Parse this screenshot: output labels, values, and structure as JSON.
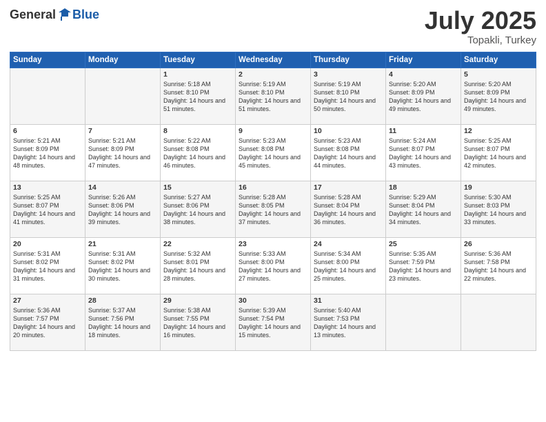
{
  "header": {
    "logo_general": "General",
    "logo_blue": "Blue",
    "month": "July 2025",
    "location": "Topakli, Turkey"
  },
  "days_of_week": [
    "Sunday",
    "Monday",
    "Tuesday",
    "Wednesday",
    "Thursday",
    "Friday",
    "Saturday"
  ],
  "weeks": [
    [
      {
        "day": "",
        "info": ""
      },
      {
        "day": "",
        "info": ""
      },
      {
        "day": "1",
        "info": "Sunrise: 5:18 AM\nSunset: 8:10 PM\nDaylight: 14 hours and 51 minutes."
      },
      {
        "day": "2",
        "info": "Sunrise: 5:19 AM\nSunset: 8:10 PM\nDaylight: 14 hours and 51 minutes."
      },
      {
        "day": "3",
        "info": "Sunrise: 5:19 AM\nSunset: 8:10 PM\nDaylight: 14 hours and 50 minutes."
      },
      {
        "day": "4",
        "info": "Sunrise: 5:20 AM\nSunset: 8:09 PM\nDaylight: 14 hours and 49 minutes."
      },
      {
        "day": "5",
        "info": "Sunrise: 5:20 AM\nSunset: 8:09 PM\nDaylight: 14 hours and 49 minutes."
      }
    ],
    [
      {
        "day": "6",
        "info": "Sunrise: 5:21 AM\nSunset: 8:09 PM\nDaylight: 14 hours and 48 minutes."
      },
      {
        "day": "7",
        "info": "Sunrise: 5:21 AM\nSunset: 8:09 PM\nDaylight: 14 hours and 47 minutes."
      },
      {
        "day": "8",
        "info": "Sunrise: 5:22 AM\nSunset: 8:08 PM\nDaylight: 14 hours and 46 minutes."
      },
      {
        "day": "9",
        "info": "Sunrise: 5:23 AM\nSunset: 8:08 PM\nDaylight: 14 hours and 45 minutes."
      },
      {
        "day": "10",
        "info": "Sunrise: 5:23 AM\nSunset: 8:08 PM\nDaylight: 14 hours and 44 minutes."
      },
      {
        "day": "11",
        "info": "Sunrise: 5:24 AM\nSunset: 8:07 PM\nDaylight: 14 hours and 43 minutes."
      },
      {
        "day": "12",
        "info": "Sunrise: 5:25 AM\nSunset: 8:07 PM\nDaylight: 14 hours and 42 minutes."
      }
    ],
    [
      {
        "day": "13",
        "info": "Sunrise: 5:25 AM\nSunset: 8:07 PM\nDaylight: 14 hours and 41 minutes."
      },
      {
        "day": "14",
        "info": "Sunrise: 5:26 AM\nSunset: 8:06 PM\nDaylight: 14 hours and 39 minutes."
      },
      {
        "day": "15",
        "info": "Sunrise: 5:27 AM\nSunset: 8:06 PM\nDaylight: 14 hours and 38 minutes."
      },
      {
        "day": "16",
        "info": "Sunrise: 5:28 AM\nSunset: 8:05 PM\nDaylight: 14 hours and 37 minutes."
      },
      {
        "day": "17",
        "info": "Sunrise: 5:28 AM\nSunset: 8:04 PM\nDaylight: 14 hours and 36 minutes."
      },
      {
        "day": "18",
        "info": "Sunrise: 5:29 AM\nSunset: 8:04 PM\nDaylight: 14 hours and 34 minutes."
      },
      {
        "day": "19",
        "info": "Sunrise: 5:30 AM\nSunset: 8:03 PM\nDaylight: 14 hours and 33 minutes."
      }
    ],
    [
      {
        "day": "20",
        "info": "Sunrise: 5:31 AM\nSunset: 8:02 PM\nDaylight: 14 hours and 31 minutes."
      },
      {
        "day": "21",
        "info": "Sunrise: 5:31 AM\nSunset: 8:02 PM\nDaylight: 14 hours and 30 minutes."
      },
      {
        "day": "22",
        "info": "Sunrise: 5:32 AM\nSunset: 8:01 PM\nDaylight: 14 hours and 28 minutes."
      },
      {
        "day": "23",
        "info": "Sunrise: 5:33 AM\nSunset: 8:00 PM\nDaylight: 14 hours and 27 minutes."
      },
      {
        "day": "24",
        "info": "Sunrise: 5:34 AM\nSunset: 8:00 PM\nDaylight: 14 hours and 25 minutes."
      },
      {
        "day": "25",
        "info": "Sunrise: 5:35 AM\nSunset: 7:59 PM\nDaylight: 14 hours and 23 minutes."
      },
      {
        "day": "26",
        "info": "Sunrise: 5:36 AM\nSunset: 7:58 PM\nDaylight: 14 hours and 22 minutes."
      }
    ],
    [
      {
        "day": "27",
        "info": "Sunrise: 5:36 AM\nSunset: 7:57 PM\nDaylight: 14 hours and 20 minutes."
      },
      {
        "day": "28",
        "info": "Sunrise: 5:37 AM\nSunset: 7:56 PM\nDaylight: 14 hours and 18 minutes."
      },
      {
        "day": "29",
        "info": "Sunrise: 5:38 AM\nSunset: 7:55 PM\nDaylight: 14 hours and 16 minutes."
      },
      {
        "day": "30",
        "info": "Sunrise: 5:39 AM\nSunset: 7:54 PM\nDaylight: 14 hours and 15 minutes."
      },
      {
        "day": "31",
        "info": "Sunrise: 5:40 AM\nSunset: 7:53 PM\nDaylight: 14 hours and 13 minutes."
      },
      {
        "day": "",
        "info": ""
      },
      {
        "day": "",
        "info": ""
      }
    ]
  ]
}
